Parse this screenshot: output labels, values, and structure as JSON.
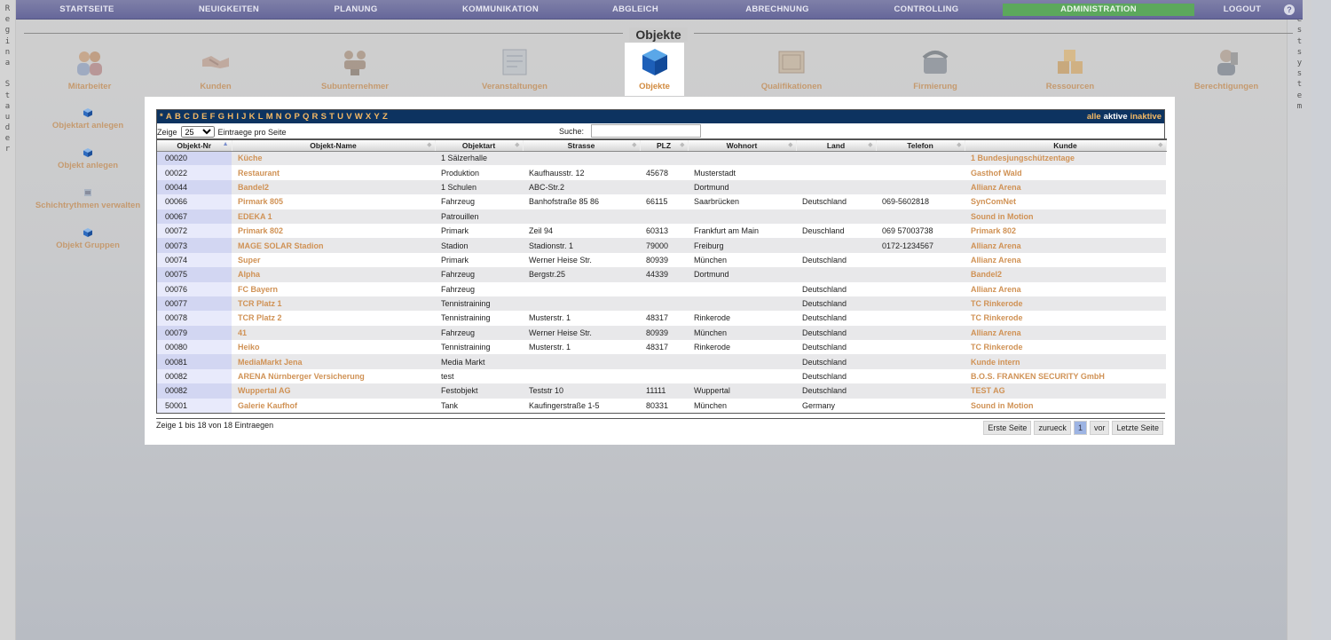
{
  "side_left": [
    "R",
    "e",
    "g",
    "i",
    "n",
    "a",
    " ",
    "S",
    "t",
    "a",
    "u",
    "d",
    "e",
    "r"
  ],
  "side_right": [
    "T",
    "e",
    "s",
    "t",
    "s",
    "y",
    "s",
    "t",
    "e",
    "m"
  ],
  "nav": [
    {
      "label": "STARTSEITE"
    },
    {
      "label": "NEUIGKEITEN"
    },
    {
      "label": "PLANUNG"
    },
    {
      "label": "KOMMUNIKATION"
    },
    {
      "label": "ABGLEICH"
    },
    {
      "label": "ABRECHNUNG"
    },
    {
      "label": "CONTROLLING"
    },
    {
      "label": "ADMINISTRATION",
      "active": true
    },
    {
      "label": "LOGOUT"
    }
  ],
  "section_title": "Objekte",
  "icons": [
    {
      "label": "Mitarbeiter",
      "icon": "people-icon"
    },
    {
      "label": "Kunden",
      "icon": "handshake-icon"
    },
    {
      "label": "Subunternehmer",
      "icon": "subcontractor-icon"
    },
    {
      "label": "Veranstaltungen",
      "icon": "document-icon"
    },
    {
      "label": "Objekte",
      "icon": "cube-icon",
      "active": true
    },
    {
      "label": "Qualifikationen",
      "icon": "certificate-icon"
    },
    {
      "label": "Firmierung",
      "icon": "phone-icon"
    },
    {
      "label": "Ressourcen",
      "icon": "boxes-icon"
    },
    {
      "label": "Berechtigungen",
      "icon": "user-key-icon"
    }
  ],
  "actions": [
    {
      "label": "Objektart anlegen"
    },
    {
      "label": "Objekt anlegen"
    },
    {
      "label": "Schichtrythmen verwalten"
    },
    {
      "label": "Objekt Gruppen"
    }
  ],
  "alphabet": [
    "*",
    "A",
    "B",
    "C",
    "D",
    "E",
    "F",
    "G",
    "H",
    "I",
    "J",
    "K",
    "L",
    "M",
    "N",
    "O",
    "P",
    "Q",
    "R",
    "S",
    "T",
    "U",
    "V",
    "W",
    "X",
    "Y",
    "Z"
  ],
  "filter": {
    "all": "alle",
    "active": "aktive",
    "inactive": "inaktive"
  },
  "controls": {
    "show_label": "Zeige",
    "page_size": "25",
    "per_page_label": "Eintraege pro Seite",
    "search_label": "Suche:",
    "search_value": ""
  },
  "columns": [
    "Objekt-Nr",
    "Objekt-Name",
    "Objektart",
    "Strasse",
    "PLZ",
    "Wohnort",
    "Land",
    "Telefon",
    "Kunde"
  ],
  "rows": [
    [
      "00020",
      "Küche",
      "1 Sälzerhalle",
      "",
      "",
      "",
      "",
      "",
      "1 Bundesjungschützentage"
    ],
    [
      "00022",
      "Restaurant",
      "Produktion",
      "Kaufhausstr. 12",
      "45678",
      "Musterstadt",
      "",
      "",
      "Gasthof Wald"
    ],
    [
      "00044",
      "Bandel2",
      "1 Schulen",
      "ABC-Str.2",
      "",
      "Dortmund",
      "",
      "",
      "Allianz Arena"
    ],
    [
      "00066",
      "Pirmark 805",
      "Fahrzeug",
      "Banhofstraße 85 86",
      "66115",
      "Saarbrücken",
      "Deutschland",
      "069-5602818",
      "SynComNet"
    ],
    [
      "00067",
      "EDEKA 1",
      "Patrouillen",
      "",
      "",
      "",
      "",
      "",
      "Sound in Motion"
    ],
    [
      "00072",
      "Primark 802",
      "Primark",
      "Zeil 94",
      "60313",
      "Frankfurt am Main",
      "Deuschland",
      "069 57003738",
      "Primark 802"
    ],
    [
      "00073",
      "MAGE SOLAR Stadion",
      "Stadion",
      "Stadionstr. 1",
      "79000",
      "Freiburg",
      "",
      "0172-1234567",
      "Allianz Arena"
    ],
    [
      "00074",
      "Super",
      "Primark",
      "Werner Heise Str.",
      "80939",
      "München",
      "Deutschland",
      "",
      "Allianz Arena"
    ],
    [
      "00075",
      "Alpha",
      "Fahrzeug",
      "Bergstr.25",
      "44339",
      "Dortmund",
      "",
      "",
      "Bandel2"
    ],
    [
      "00076",
      "FC Bayern",
      "Fahrzeug",
      "",
      "",
      "",
      "Deutschland",
      "",
      "Allianz Arena"
    ],
    [
      "00077",
      "TCR Platz 1",
      "Tennistraining",
      "",
      "",
      "",
      "Deutschland",
      "",
      "TC Rinkerode"
    ],
    [
      "00078",
      "TCR Platz 2",
      "Tennistraining",
      "Musterstr. 1",
      "48317",
      "Rinkerode",
      "Deutschland",
      "",
      "TC Rinkerode"
    ],
    [
      "00079",
      "41",
      "Fahrzeug",
      "Werner Heise Str.",
      "80939",
      "München",
      "Deutschland",
      "",
      "Allianz Arena"
    ],
    [
      "00080",
      "Heiko",
      "Tennistraining",
      "Musterstr. 1",
      "48317",
      "Rinkerode",
      "Deutschland",
      "",
      "TC Rinkerode"
    ],
    [
      "00081",
      "MediaMarkt Jena",
      "Media Markt",
      "",
      "",
      "",
      "Deutschland",
      "",
      "Kunde intern"
    ],
    [
      "00082",
      "ARENA Nürnberger Versicherung",
      "test",
      "",
      "",
      "",
      "Deutschland",
      "",
      "B.O.S. FRANKEN SECURITY GmbH"
    ],
    [
      "00082",
      "Wuppertal AG",
      "Festobjekt",
      "Teststr 10",
      "11111",
      "Wuppertal",
      "Deutschland",
      "",
      "TEST AG"
    ],
    [
      "50001",
      "Galerie Kaufhof",
      "Tank",
      "Kaufingerstraße 1-5",
      "80331",
      "München",
      "Germany",
      "",
      "Sound in Motion"
    ]
  ],
  "footer": {
    "info": "Zeige 1 bis 18 von 18 Eintraegen",
    "first": "Erste Seite",
    "prev": "zurueck",
    "current": "1",
    "next": "vor",
    "last": "Letzte Seite"
  }
}
